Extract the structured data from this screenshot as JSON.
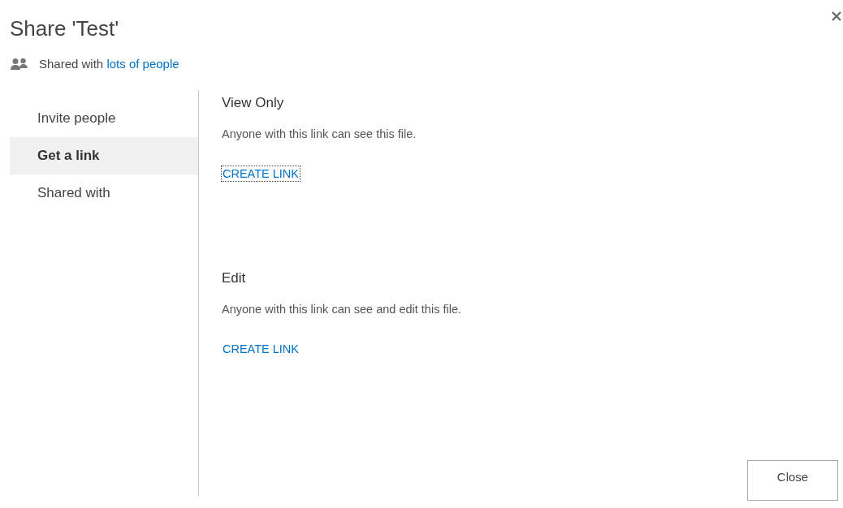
{
  "dialog": {
    "title": "Share 'Test'",
    "shared_text": "Shared with",
    "shared_link": "lots of people"
  },
  "nav": [
    {
      "label": "Invite people",
      "selected": false
    },
    {
      "label": "Get a link",
      "selected": true
    },
    {
      "label": "Shared with",
      "selected": false
    }
  ],
  "sections": [
    {
      "heading": "View Only",
      "description": "Anyone with this link can see this file.",
      "link": "CREATE LINK",
      "focused": true
    },
    {
      "heading": "Edit",
      "description": "Anyone with this link can see and edit this file.",
      "link": "CREATE LINK",
      "focused": false
    }
  ],
  "buttons": [
    "Close"
  ]
}
